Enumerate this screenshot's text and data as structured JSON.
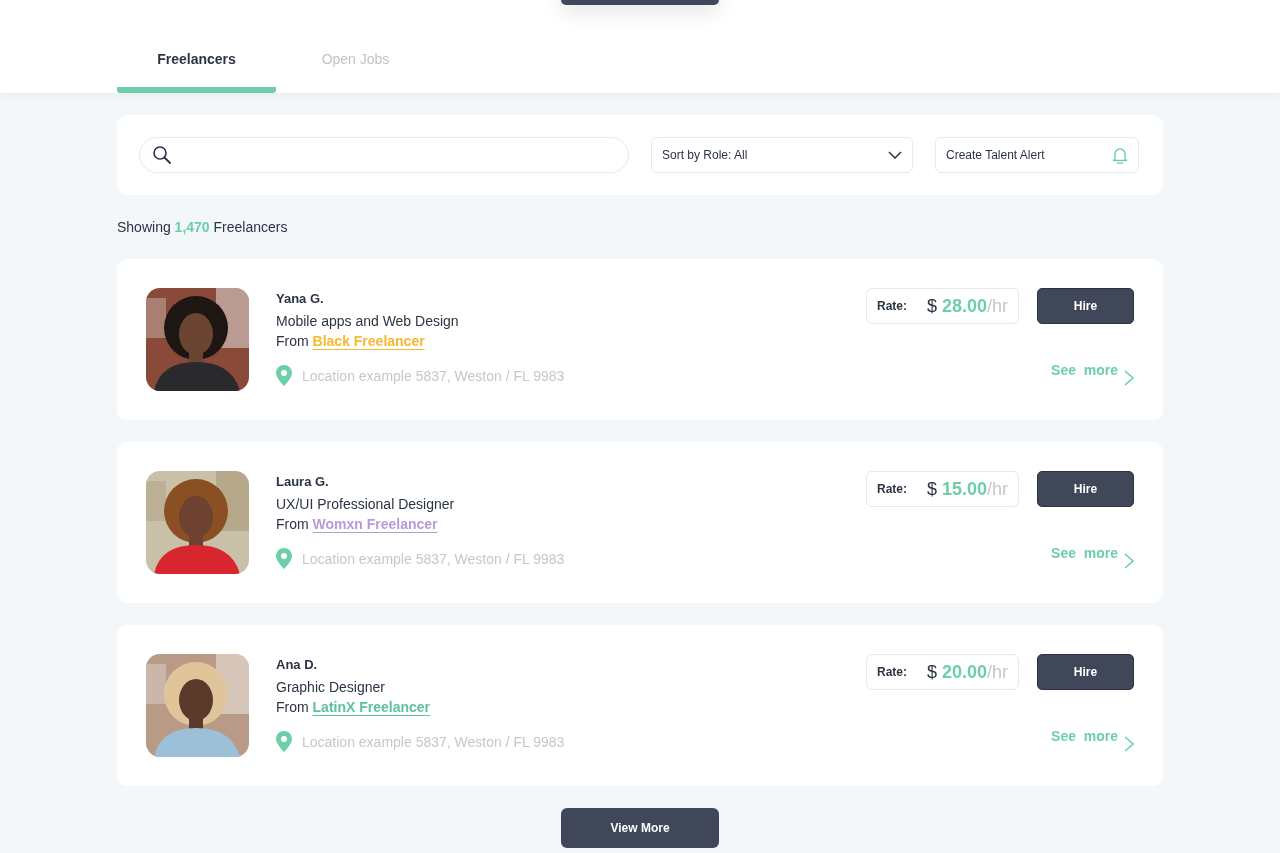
{
  "tabs": [
    {
      "label": "Freelancers",
      "selected": true
    },
    {
      "label": "Open Jobs",
      "selected": false
    }
  ],
  "sort": {
    "value": "Sort by Role: All"
  },
  "alert_button": {
    "label": "Create Talent Alert"
  },
  "summary": {
    "prefix": "Showing",
    "count": "1,470",
    "suffix": "Freelancers"
  },
  "freelancers": [
    {
      "name": "Yana G.",
      "role": "Mobile apps and Web Design",
      "from_label": "From",
      "source": "Black Freelancer",
      "color": "#f5b82e",
      "location": "Location example 5837, Weston / FL 9983",
      "rate_label": "Rate:",
      "currency": "$",
      "rate": "28.00",
      "unit": "/hr",
      "hire": "Hire",
      "see_more": "See  more"
    },
    {
      "name": "Laura G.",
      "role": "UX/UI Professional Designer",
      "from_label": "From",
      "source": "Womxn Freelancer",
      "color": "#b89ad6",
      "location": "Location example 5837, Weston / FL 9983",
      "rate_label": "Rate:",
      "currency": "$",
      "rate": "15.00",
      "unit": "/hr",
      "hire": "Hire",
      "see_more": "See  more"
    },
    {
      "name": "Ana D.",
      "role": "Graphic Designer",
      "from_label": "From",
      "source": "LatinX Freelancer",
      "color": "#5cc29e",
      "location": "Location example 5837, Weston / FL 9983",
      "rate_label": "Rate:",
      "currency": "$",
      "rate": "20.00",
      "unit": "/hr",
      "hire": "Hire",
      "see_more": "See  more"
    }
  ],
  "view_more": {
    "label": "View More"
  }
}
